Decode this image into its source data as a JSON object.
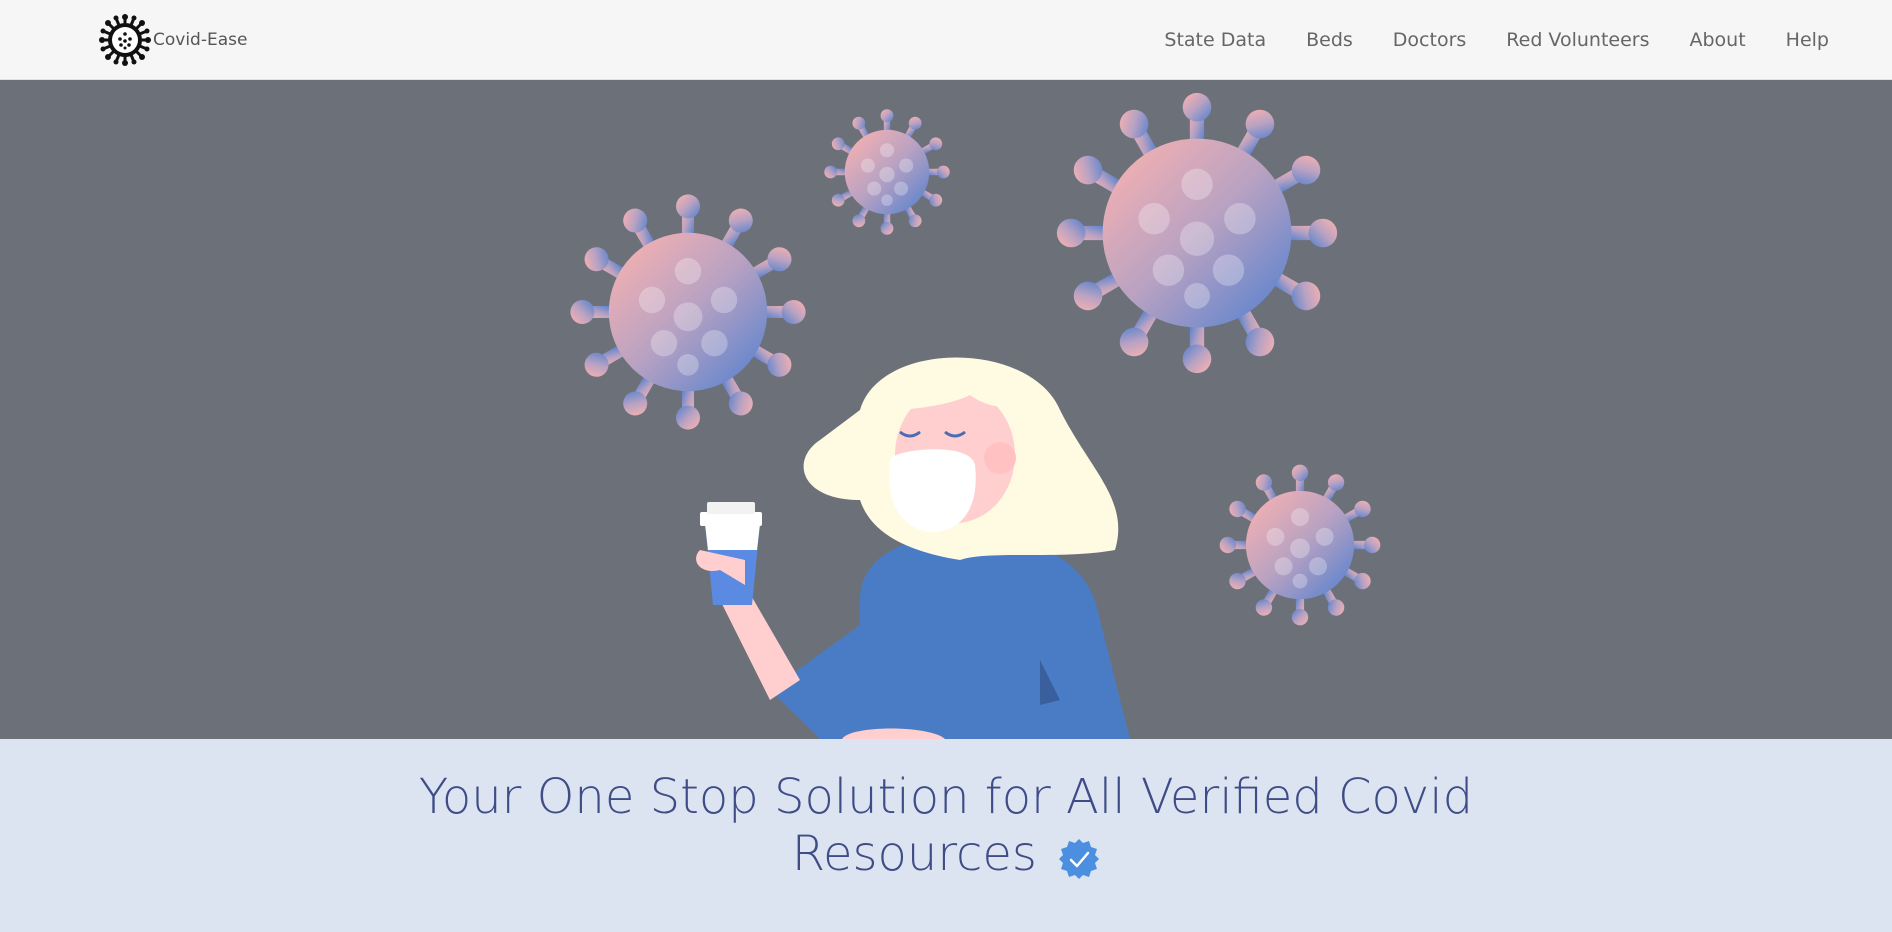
{
  "brand": {
    "name": "Covid-Ease",
    "logo_icon": "virus-icon"
  },
  "nav": {
    "items": [
      {
        "label": "State Data"
      },
      {
        "label": "Beds"
      },
      {
        "label": "Doctors"
      },
      {
        "label": "Red Volunteers"
      },
      {
        "label": "About"
      },
      {
        "label": "Help"
      }
    ]
  },
  "hero": {
    "image": "woman-with-mask-holding-coffee-among-viruses-illustration"
  },
  "tagline": {
    "line1": "Your One Stop Solution for All Verified Covid",
    "line2": "Resources",
    "badge_icon": "verified-badge-icon"
  },
  "colors": {
    "navbar_bg": "#f6f6f6",
    "hero_bg": "#6c7078",
    "band_bg": "#dce4f2",
    "tagline_text": "#3f4d86",
    "nav_text": "#666666",
    "accent_blue": "#4a7cc5",
    "virus_pink": "#ffb1ac"
  }
}
